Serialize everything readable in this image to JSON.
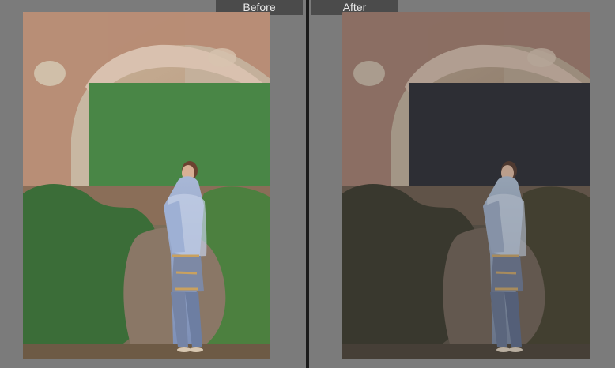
{
  "labels": {
    "before": "Before",
    "after": "After"
  },
  "colors": {
    "background": "#7b7b7b",
    "label_bg": "#4b4b4b",
    "label_text": "#e9e9e9",
    "divider": "#1b1b1b"
  }
}
